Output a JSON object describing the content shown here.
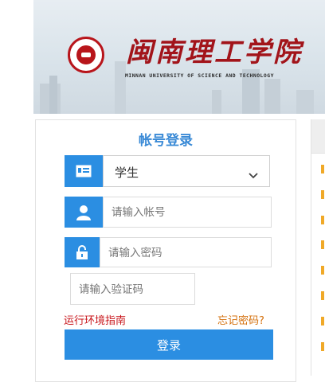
{
  "banner": {
    "university_name": "闽南理工学院",
    "university_name_en": "MINNAN UNIVERSITY OF SCIENCE AND TECHNOLOGY",
    "logo_icon": "university-seal-icon"
  },
  "login": {
    "title": "帐号登录",
    "role_select": {
      "value": "学生"
    },
    "username": {
      "placeholder": "请输入帐号",
      "icon": "user-icon"
    },
    "password": {
      "placeholder": "请输入密码",
      "icon": "lock-icon"
    },
    "captcha": {
      "placeholder": "请输入验证码"
    },
    "env_guide_link": "运行环境指南",
    "forgot_password_link": "忘记密码?",
    "submit_label": "登录"
  },
  "colors": {
    "accent": "#2b8ee2",
    "title": "#3a8ad6",
    "brand_red": "#a2141a",
    "link_red": "#c8141a",
    "link_orange": "#d4700d"
  }
}
